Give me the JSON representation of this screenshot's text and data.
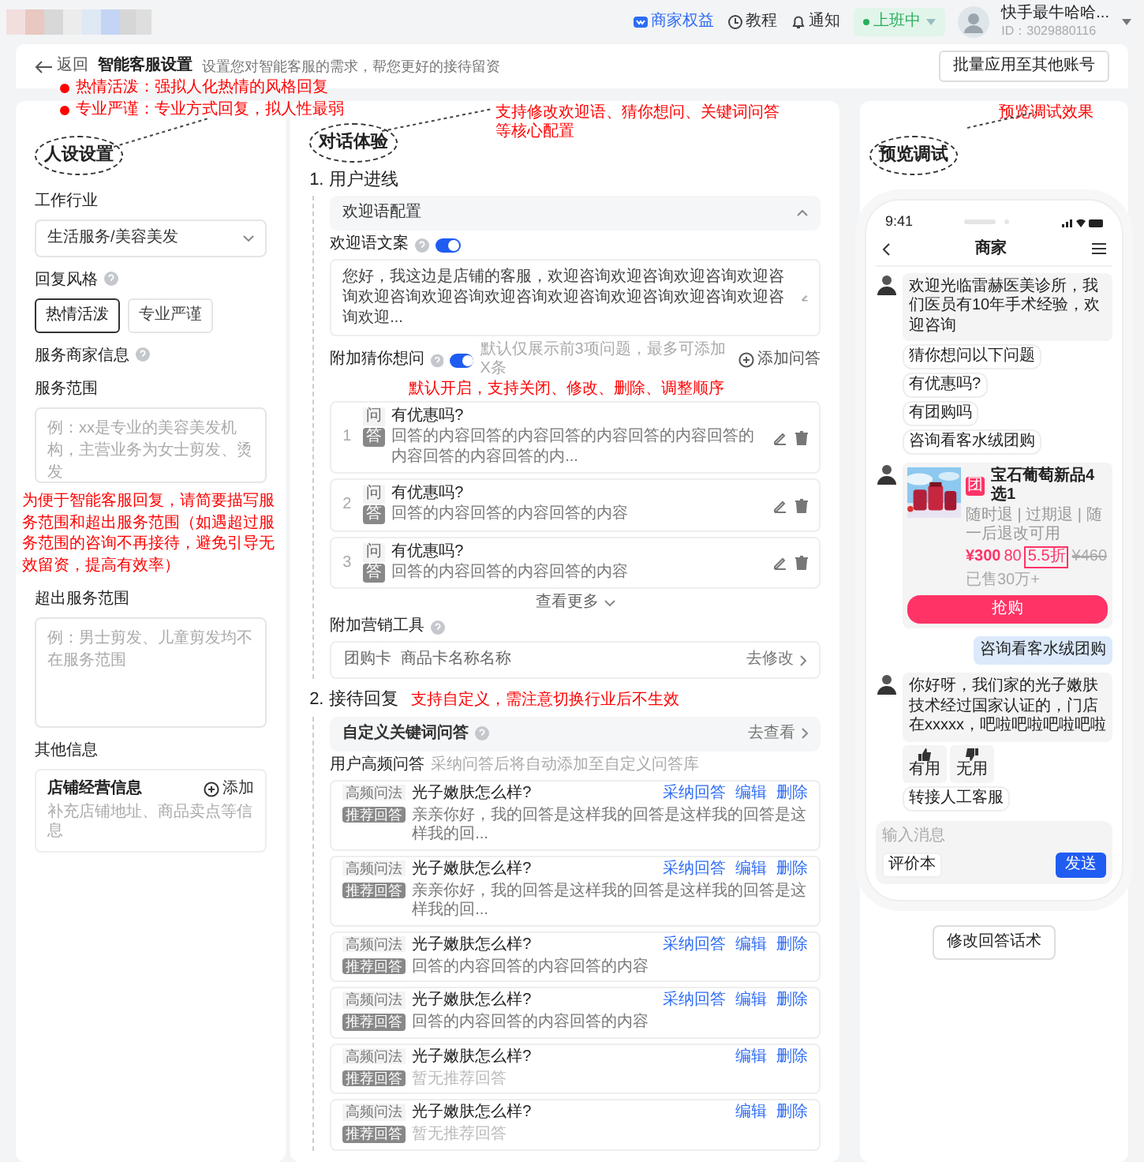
{
  "header": {
    "benefits": "商家权益",
    "tutorial": "教程",
    "notice": "通知",
    "status": {
      "label": "上班中",
      "on": true
    },
    "user": {
      "name": "快手最牛哈哈...",
      "id": "ID：3029880116"
    }
  },
  "top": {
    "back": "返回",
    "title": "智能客服设置",
    "description": "设置您对智能客服的需求，帮您更好的接待留资",
    "batch_button": "批量应用至其他账号",
    "notes": [
      "热情活泼：强拟人化热情的风格回复",
      "专业严谨：专业方式回复，拟人性最弱"
    ]
  },
  "persona": {
    "title": "人设设置",
    "industry_label": "工作行业",
    "industry_value": "生活服务/美容美发",
    "style_label": "回复风格",
    "styles": [
      {
        "label": "热情活泼",
        "selected": true
      },
      {
        "label": "专业严谨",
        "selected": false
      }
    ],
    "merchant_info_label": "服务商家信息",
    "scope_label": "服务范围",
    "scope_placeholder": "例：xx是专业的美容美发机构，主营业务为女士剪发、烫发",
    "scope_note": "为便于智能客服回复，请简要描写服务范围和超出服务范围（如遇超过服务范围的咨询不再接待，避免引导无效留资，提高有效率）",
    "out_scope_label": "超出服务范围",
    "out_scope_placeholder": "例：男士剪发、儿童剪发均不在服务范围",
    "other_label": "其他信息",
    "shop_info": {
      "title": "店铺经营信息",
      "add": "添加",
      "hint": "补充店铺地址、商品卖点等信息"
    }
  },
  "dialog": {
    "title": "对话体验",
    "note": "支持修改欢迎语、猜你想问、关键词问答等核心配置",
    "section1": "1. 用户进线",
    "welcome_config": {
      "title": "欢迎语配置",
      "expanded": true
    },
    "welcome_copy": {
      "label": "欢迎语文案",
      "on": true,
      "text": "您好，我这边是店铺的客服，欢迎咨询欢迎咨询欢迎咨询欢迎咨询欢迎咨询欢迎咨询欢迎咨询欢迎咨询欢迎咨询欢迎咨询欢迎咨询欢迎..."
    },
    "guess": {
      "label": "附加猜你想问",
      "on": true,
      "hint": "默认仅展示前3项问题，最多可添加X条",
      "add": "添加问答",
      "note": "默认开启，支持关闭、修改、删除、调整顺序",
      "items": [
        {
          "index": "1",
          "q_tag": "问",
          "question": "有优惠吗?",
          "a_tag": "答",
          "answer": "回答的内容回答的内容回答的内容回答的内容回答的内容回答的内容回答的内..."
        },
        {
          "index": "2",
          "q_tag": "问",
          "question": "有优惠吗?",
          "a_tag": "答",
          "answer": "回答的内容回答的内容回答的内容"
        },
        {
          "index": "3",
          "q_tag": "问",
          "question": "有优惠吗?",
          "a_tag": "答",
          "answer": "回答的内容回答的内容回答的内容"
        }
      ],
      "more": "查看更多"
    },
    "tools": {
      "label": "附加营销工具",
      "card_type": "团购卡",
      "card_name": "商品卡名称名称",
      "action": "去修改"
    },
    "section2": "2. 接待回复",
    "section2_note": "支持自定义，需注意切换行业后不生效",
    "custom": {
      "title": "自定义关键词问答",
      "action": "去查看"
    },
    "faq": {
      "label": "用户高频问答",
      "hint": "采纳问答后将自动添加至自定义问答库",
      "items": [
        {
          "q_tag": "高频问法",
          "question": "光子嫩肤怎么样?",
          "a_tag": "推荐回答",
          "answer": "亲亲你好，我的回答是这样我的回答是这样我的回答是这样我的回...",
          "empty": false,
          "actions": [
            "采纳回答",
            "编辑",
            "删除"
          ]
        },
        {
          "q_tag": "高频问法",
          "question": "光子嫩肤怎么样?",
          "a_tag": "推荐回答",
          "answer": "亲亲你好，我的回答是这样我的回答是这样我的回答是这样我的回...",
          "empty": false,
          "actions": [
            "采纳回答",
            "编辑",
            "删除"
          ]
        },
        {
          "q_tag": "高频问法",
          "question": "光子嫩肤怎么样?",
          "a_tag": "推荐回答",
          "answer": "回答的内容回答的内容回答的内容",
          "empty": false,
          "actions": [
            "采纳回答",
            "编辑",
            "删除"
          ]
        },
        {
          "q_tag": "高频问法",
          "question": "光子嫩肤怎么样?",
          "a_tag": "推荐回答",
          "answer": "回答的内容回答的内容回答的内容",
          "empty": false,
          "actions": [
            "采纳回答",
            "编辑",
            "删除"
          ]
        },
        {
          "q_tag": "高频问法",
          "question": "光子嫩肤怎么样?",
          "a_tag": "推荐回答",
          "answer": "暂无推荐回答",
          "empty": true,
          "actions": [
            "编辑",
            "删除"
          ]
        },
        {
          "q_tag": "高频问法",
          "question": "光子嫩肤怎么样?",
          "a_tag": "推荐回答",
          "answer": "暂无推荐回答",
          "empty": true,
          "actions": [
            "编辑",
            "删除"
          ]
        }
      ]
    }
  },
  "preview": {
    "title": "预览调试",
    "note": "预览调试效果",
    "phone": {
      "time": "9:41",
      "title": "商家",
      "messages": [
        {
          "kind": "bot",
          "text": "欢迎光临雷赫医美诊所，我们医员有10年手术经验，欢迎咨询",
          "chips_title": "猜你想问以下问题",
          "chips": [
            "有优惠吗?",
            "有团购吗",
            "咨询看客水绒团购"
          ]
        },
        {
          "kind": "product",
          "badge": "团",
          "name": "宝石葡萄新品4选1",
          "tags": "随时退 | 过期退 | 随一后退改可用",
          "price": "¥300",
          "price_suffix": "80",
          "discount": "5.5折",
          "original_price": "¥460",
          "sold": "已售30万+",
          "button": "抢购"
        },
        {
          "kind": "user",
          "text": "咨询看客水绒团购"
        },
        {
          "kind": "bot",
          "text": "你好呀，我们家的光子嫩肤技术经过国家认证的，门店在xxxxx，吧啦吧啦吧啦吧啦",
          "feedback": [
            "有用",
            "无用"
          ],
          "footer_chip": "转接人工客服"
        }
      ],
      "input_placeholder": "输入消息",
      "rate": "评价本",
      "send": "发送"
    },
    "edit_button": "修改回答话术"
  }
}
